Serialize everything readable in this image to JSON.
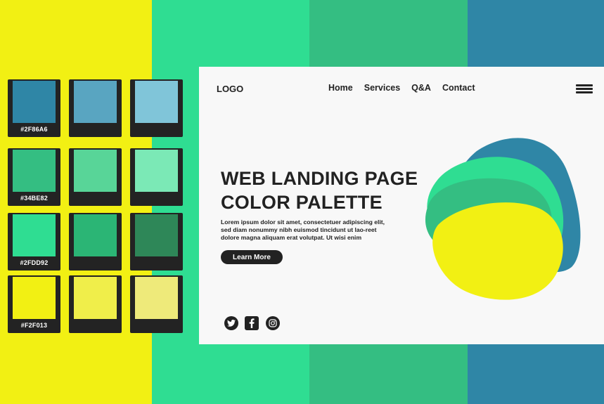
{
  "colors": {
    "yellow": "#F2F013",
    "green": "#2FDD92",
    "mid_green": "#34BE82",
    "blue": "#2F86A6",
    "dark": "#232323",
    "card": "#F8F8F8"
  },
  "palette": {
    "rows": [
      {
        "swatches": [
          {
            "color": "#2F86A6",
            "hex": "#2F86A6"
          },
          {
            "color": "#59A5C1",
            "hex": ""
          },
          {
            "color": "#80C5D9",
            "hex": ""
          }
        ]
      },
      {
        "swatches": [
          {
            "color": "#34BE82",
            "hex": "#34BE82"
          },
          {
            "color": "#58D598",
            "hex": ""
          },
          {
            "color": "#7BE9B6",
            "hex": ""
          }
        ]
      },
      {
        "swatches": [
          {
            "color": "#2FDD92",
            "hex": "#2FDD92"
          },
          {
            "color": "#2BB575",
            "hex": ""
          },
          {
            "color": "#2E8758",
            "hex": ""
          }
        ]
      },
      {
        "swatches": [
          {
            "color": "#F2F013",
            "hex": "#F2F013"
          },
          {
            "color": "#F0EE4A",
            "hex": ""
          },
          {
            "color": "#EEEA7A",
            "hex": ""
          }
        ]
      }
    ]
  },
  "landing": {
    "logo": "LOGO",
    "nav": [
      "Home",
      "Services",
      "Q&A",
      "Contact"
    ],
    "title_line1": "WEB LANDING PAGE",
    "title_line2": "COLOR PALETTE",
    "body": "Lorem ipsum dolor sit amet, consectetuer adipiscing elit, sed diam nonummy nibh euismod tincidunt ut lao-reet dolore magna aliquam erat volutpat. Ut wisi enim",
    "cta": "Learn More",
    "social_icons": [
      "twitter-icon",
      "facebook-icon",
      "instagram-icon"
    ]
  }
}
